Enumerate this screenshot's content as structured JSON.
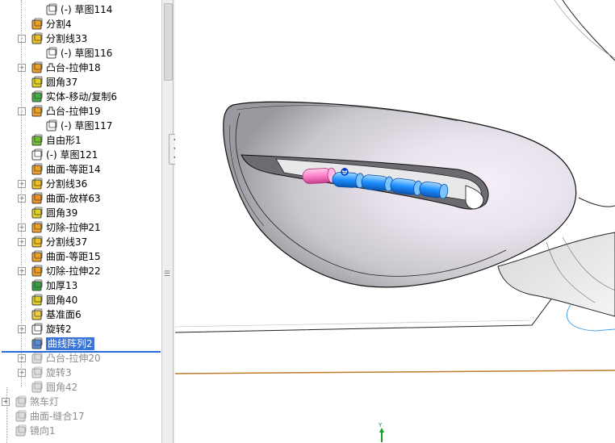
{
  "feature_tree": {
    "items": [
      {
        "label": "(-) 草图114",
        "icon": "sketch-icon",
        "state": "normal"
      },
      {
        "label": "分割4",
        "icon": "split-icon",
        "state": "normal"
      },
      {
        "label": "分割线33",
        "icon": "split-line-icon",
        "state": "normal"
      },
      {
        "label": "(-) 草图116",
        "icon": "sketch-icon",
        "state": "normal"
      },
      {
        "label": "凸台-拉伸18",
        "icon": "boss-extrude-icon",
        "state": "normal"
      },
      {
        "label": "圆角37",
        "icon": "fillet-icon",
        "state": "normal"
      },
      {
        "label": "实体-移动/复制6",
        "icon": "move-copy-body-icon",
        "state": "normal"
      },
      {
        "label": "凸台-拉伸19",
        "icon": "boss-extrude-icon",
        "state": "normal"
      },
      {
        "label": "(-) 草图117",
        "icon": "sketch-icon",
        "state": "normal"
      },
      {
        "label": "自由形1",
        "icon": "freeform-icon",
        "state": "normal"
      },
      {
        "label": "(-) 草图121",
        "icon": "sketch-icon",
        "state": "normal"
      },
      {
        "label": "曲面-等距14",
        "icon": "offset-surface-icon",
        "state": "normal"
      },
      {
        "label": "分割线36",
        "icon": "split-line-icon",
        "state": "normal"
      },
      {
        "label": "曲面-放样63",
        "icon": "loft-surface-icon",
        "state": "normal"
      },
      {
        "label": "圆角39",
        "icon": "fillet-icon",
        "state": "normal"
      },
      {
        "label": "切除-拉伸21",
        "icon": "cut-extrude-icon",
        "state": "normal"
      },
      {
        "label": "分割线37",
        "icon": "split-line-icon",
        "state": "normal"
      },
      {
        "label": "曲面-等距15",
        "icon": "offset-surface-icon",
        "state": "normal"
      },
      {
        "label": "切除-拉伸22",
        "icon": "cut-extrude-icon",
        "state": "normal"
      },
      {
        "label": "加厚13",
        "icon": "thicken-icon",
        "state": "normal"
      },
      {
        "label": "圆角40",
        "icon": "fillet-icon",
        "state": "normal"
      },
      {
        "label": "基准面6",
        "icon": "plane-icon",
        "state": "normal"
      },
      {
        "label": "旋转2",
        "icon": "revolve-icon",
        "state": "normal"
      },
      {
        "label": "曲线阵列2",
        "icon": "curve-pattern-icon",
        "state": "selected"
      },
      {
        "label": "凸台-拉伸20",
        "icon": "boss-extrude-icon",
        "state": "suppressed"
      },
      {
        "label": "旋转3",
        "icon": "revolve-icon",
        "state": "suppressed"
      },
      {
        "label": "圆角42",
        "icon": "fillet-icon",
        "state": "suppressed"
      },
      {
        "label": "煞车灯",
        "icon": "folder-icon",
        "state": "suppressed"
      },
      {
        "label": "曲面-缝合17",
        "icon": "knit-surface-icon",
        "state": "suppressed"
      },
      {
        "label": "镜向1",
        "icon": "mirror-icon",
        "state": "suppressed"
      }
    ]
  },
  "viewport": {
    "triad_axis_label": "Y"
  },
  "colors": {
    "selection": "#3b74d8",
    "rollback_bar": "#2a6ad8",
    "pattern_seed": "#ff7fc8",
    "pattern_instance": "#1e8fff",
    "ground_line": "#c07a2a"
  }
}
